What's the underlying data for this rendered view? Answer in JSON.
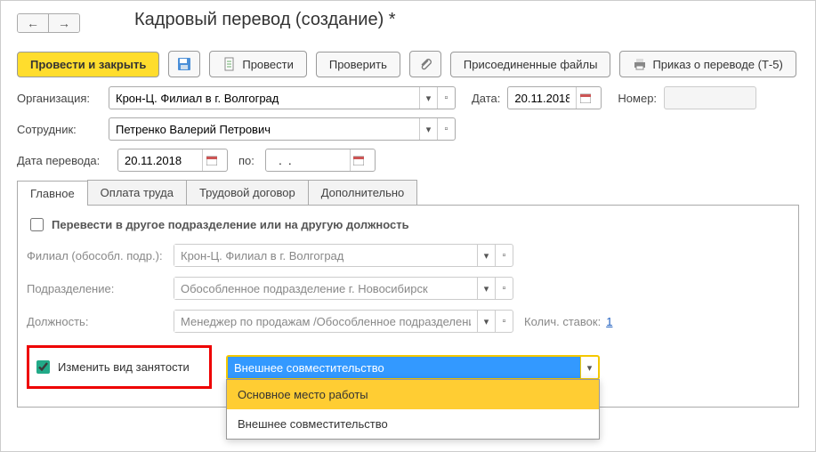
{
  "nav": {
    "back": "←",
    "fwd": "→"
  },
  "title": "Кадровый перевод (создание) *",
  "toolbar": {
    "post_close": "Провести и закрыть",
    "post": "Провести",
    "check": "Проверить",
    "files": "Присоединенные файлы",
    "print": "Приказ о переводе (Т-5)"
  },
  "form": {
    "org_label": "Организация:",
    "org_value": "Крон-Ц. Филиал в г. Волгоград",
    "date_label": "Дата:",
    "date_value": "20.11.2018",
    "number_label": "Номер:",
    "employee_label": "Сотрудник:",
    "employee_value": "Петренко Валерий Петрович",
    "transfer_date_label": "Дата перевода:",
    "transfer_date_value": "20.11.2018",
    "to_label": "по:",
    "to_value": "  .  .    "
  },
  "tabs": {
    "main": "Главное",
    "pay": "Оплата труда",
    "contract": "Трудовой договор",
    "extra": "Дополнительно"
  },
  "tab_main": {
    "chk_transfer": "Перевести в другое подразделение или на другую должность",
    "branch_label": "Филиал (обособл. подр.):",
    "branch_value": "Крон-Ц. Филиал в г. Волгоград",
    "dept_label": "Подразделение:",
    "dept_value": "Обособленное подразделение г. Новосибирск",
    "position_label": "Должность:",
    "position_value": "Менеджер по продажам /Обособленное подразделение г. Н",
    "rates_label": "Колич. ставок:",
    "rates_value": "1",
    "chk_emp_type": "Изменить вид занятости",
    "emp_type_value": "Внешнее совместительство",
    "emp_type_options": {
      "opt1": "Основное место работы",
      "opt2": "Внешнее совместительство"
    }
  }
}
